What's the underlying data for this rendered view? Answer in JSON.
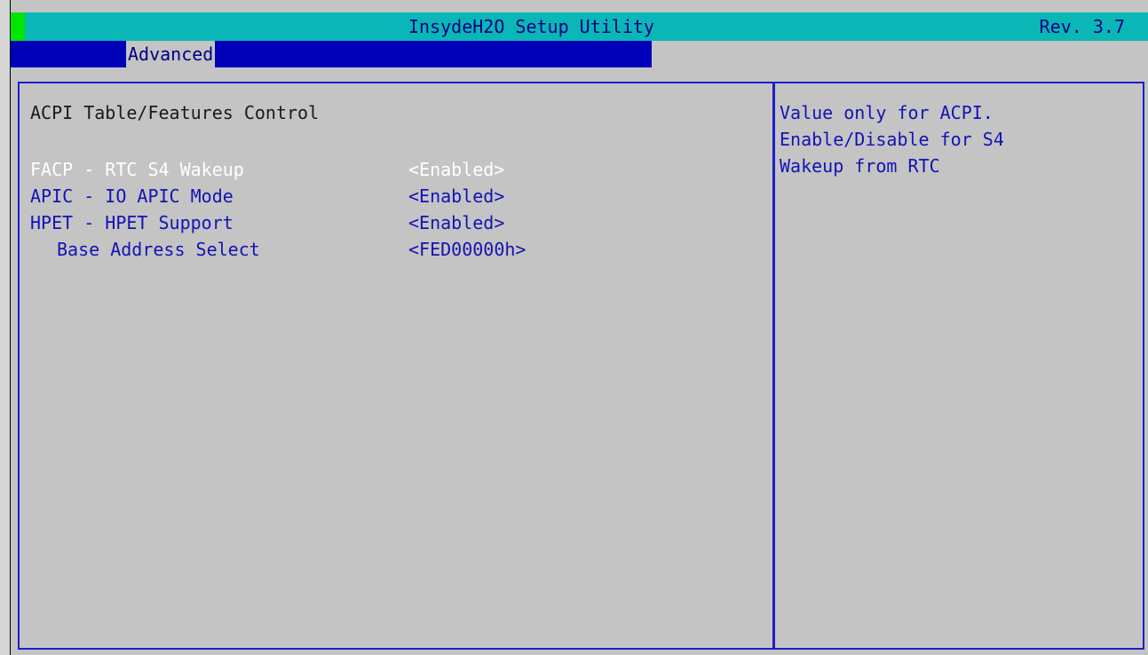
{
  "window": {
    "title": "InsydeH2O Setup Utility",
    "revision": "Rev. 3.7"
  },
  "menu": {
    "tabs": [
      {
        "label": "Advanced",
        "selected": true
      }
    ]
  },
  "main": {
    "section_title": "ACPI Table/Features Control",
    "settings": [
      {
        "label": "FACP - RTC S4 Wakeup",
        "value": "<Enabled>",
        "selected": true
      },
      {
        "label": "APIC - IO APIC Mode",
        "value": "<Enabled>",
        "selected": false
      },
      {
        "label": "HPET - HPET Support",
        "value": "<Enabled>",
        "selected": false
      },
      {
        "label": "Base Address Select",
        "value": "<FED00000h>",
        "selected": false
      }
    ]
  },
  "help": {
    "lines": [
      "Value only for ACPI.",
      "Enable/Disable for S4",
      "Wakeup from RTC"
    ]
  },
  "colors": {
    "titlebar": "#0ab6b6",
    "menubar": "#0000b8",
    "background": "#c4c4c4",
    "accent_marker": "#00e600",
    "text_blue": "#1313b5",
    "selected_text": "#ffffff",
    "panel_border": "#1e1ecc"
  }
}
